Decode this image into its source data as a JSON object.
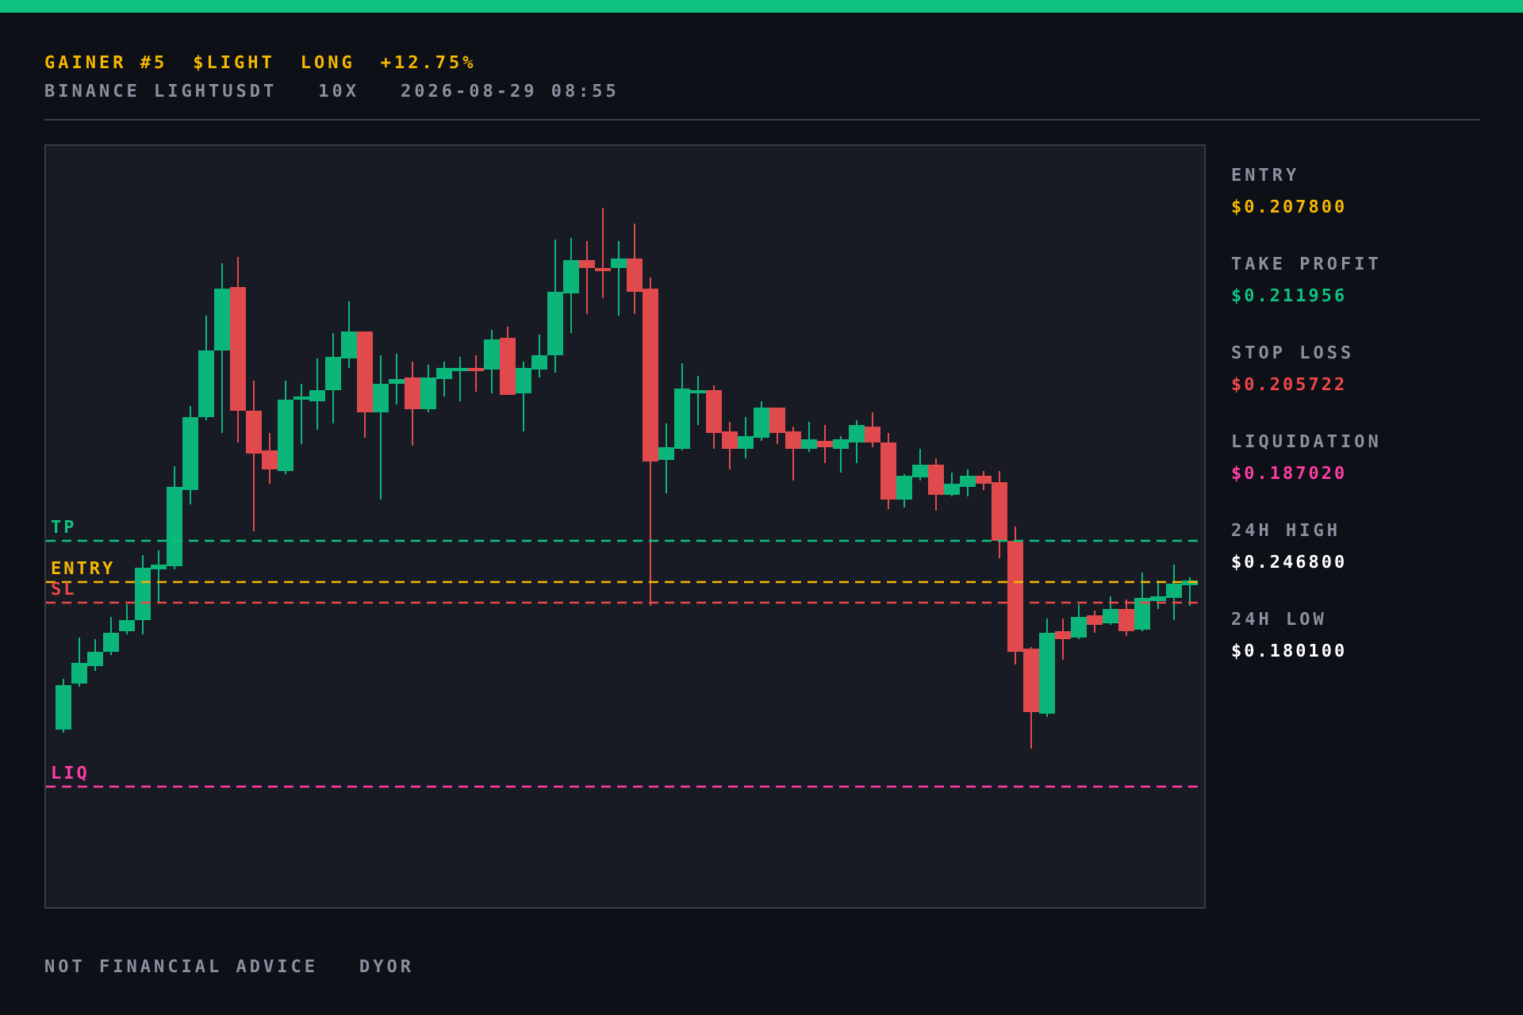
{
  "header": {
    "title_parts": [
      {
        "text": "GAINER #5"
      },
      {
        "text": "$LIGHT"
      },
      {
        "text": "LONG"
      },
      {
        "text": "+12.75%"
      }
    ],
    "subtitle_parts": [
      {
        "text": "BINANCE LIGHTUSDT"
      },
      {
        "text": "10X"
      },
      {
        "text": "2026-08-29 08:55"
      }
    ]
  },
  "chart": {
    "levels": [
      {
        "kind": "tp",
        "label": "TP",
        "color": "#0fc27f"
      },
      {
        "kind": "entry",
        "label": "ENTRY",
        "color": "#f5b800"
      },
      {
        "kind": "sl",
        "label": "SL",
        "color": "#e8484c"
      },
      {
        "kind": "liq",
        "label": "LIQ",
        "color": "#ff3ea5"
      }
    ]
  },
  "stats": [
    {
      "label": "ENTRY",
      "value": "$0.207800",
      "color": "#f5b800"
    },
    {
      "label": "TAKE PROFIT",
      "value": "$0.211956",
      "color": "#0fc27f"
    },
    {
      "label": "STOP LOSS",
      "value": "$0.205722",
      "color": "#f0474a"
    },
    {
      "label": "LIQUIDATION",
      "value": "$0.187020",
      "color": "#ff3ea5"
    },
    {
      "label": "24H HIGH",
      "value": "$0.246800",
      "color": "#ffffff"
    },
    {
      "label": "24H LOW",
      "value": "$0.180100",
      "color": "#ffffff"
    }
  ],
  "footer": [
    {
      "text": "NOT FINANCIAL ADVICE"
    },
    {
      "text": "DYOR"
    }
  ]
}
